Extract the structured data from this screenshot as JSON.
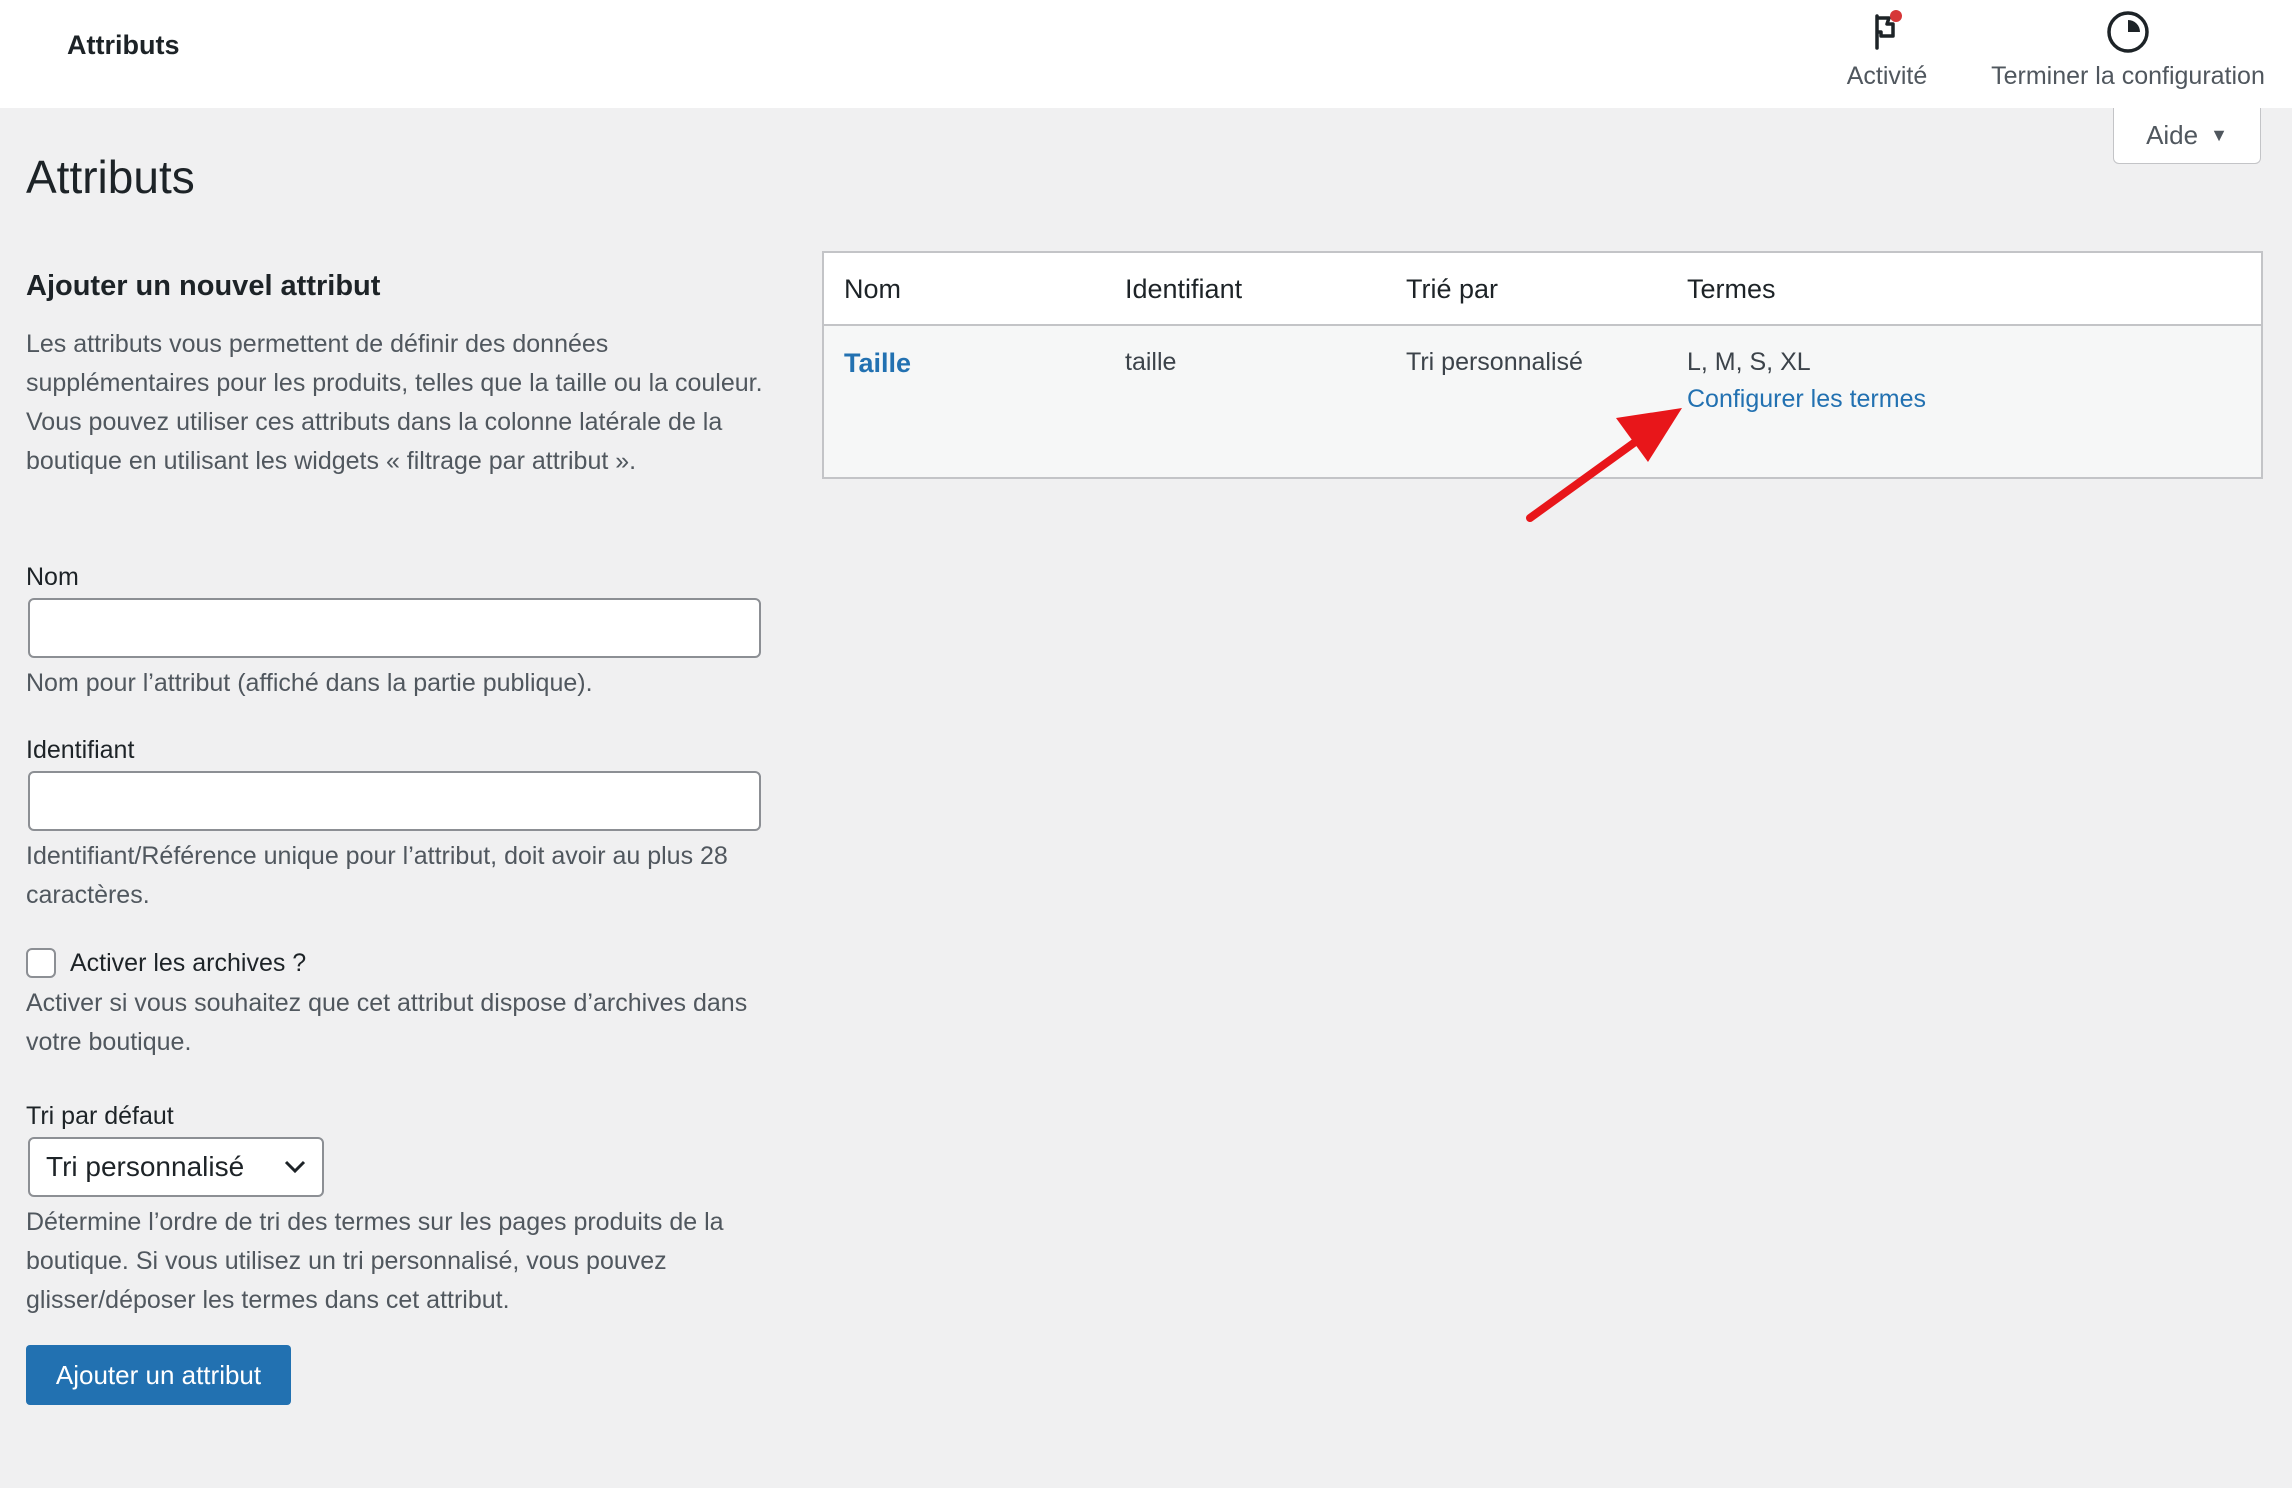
{
  "topbar": {
    "title": "Attributs",
    "activity_label": "Activité",
    "setup_label": "Terminer la configuration"
  },
  "help": {
    "label": "Aide"
  },
  "page": {
    "title": "Attributs"
  },
  "form": {
    "heading": "Ajouter un nouvel attribut",
    "intro": "Les attributs vous permettent de définir des données supplémentaires pour les produits, telles que la taille ou la couleur. Vous pouvez utiliser ces attributs dans la colonne latérale de la boutique en utilisant les widgets « filtrage par attribut ».",
    "name_label": "Nom",
    "name_value": "",
    "name_help": "Nom pour l’attribut (affiché dans la partie publique).",
    "slug_label": "Identifiant",
    "slug_value": "",
    "slug_help": "Identifiant/Référence unique pour l’attribut, doit avoir au plus 28 caractères.",
    "archives_label": "Activer les archives ?",
    "archives_checked": false,
    "archives_help": "Activer si vous souhaitez que cet attribut dispose d’archives dans votre boutique.",
    "sort_label": "Tri par défaut",
    "sort_value": "Tri personnalisé",
    "sort_help": "Détermine l’ordre de tri des termes sur les pages produits de la boutique. Si vous utilisez un tri personnalisé, vous pouvez glisser/déposer les termes dans cet attribut.",
    "submit_label": "Ajouter un attribut"
  },
  "table": {
    "columns": [
      "Nom",
      "Identifiant",
      "Trié par",
      "Termes"
    ],
    "rows": [
      {
        "name": "Taille",
        "slug": "taille",
        "sort": "Tri personnalisé",
        "terms": "L, M, S, XL",
        "configure_link": "Configurer les termes"
      }
    ]
  },
  "colors": {
    "accent": "#2271b1",
    "background": "#f0f0f1",
    "annotation_arrow": "#e8161a",
    "notification_dot": "#d63638"
  },
  "icons": {
    "activity": "flag-icon",
    "setup": "progress-circle-icon",
    "help_caret": "caret-down-icon",
    "select_caret": "chevron-down-icon"
  }
}
